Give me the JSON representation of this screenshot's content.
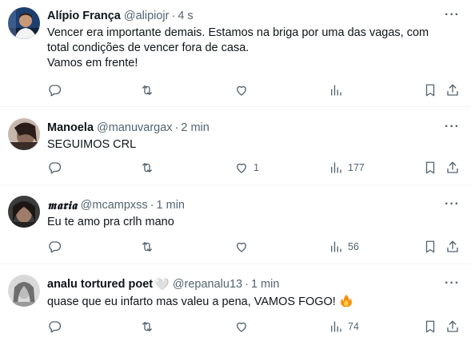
{
  "tweets": [
    {
      "name": "Alípio França",
      "handle": "@alipiojr",
      "separator": "·",
      "time": "4 s",
      "text_lines": [
        "Vencer era importante demais. Estamos na briga por uma das vagas, com",
        "total condições de vencer fora de casa.",
        "Vamos em frente!"
      ],
      "likes": "",
      "views": ""
    },
    {
      "name": "Manoela",
      "handle": "@manuvargax",
      "separator": "·",
      "time": "2 min",
      "text_lines": [
        "SEGUIMOS CRL"
      ],
      "likes": "1",
      "views": "177"
    },
    {
      "name": "𝖒𝖆𝖗𝖎𝖆",
      "handle": "@mcampxss",
      "separator": "·",
      "time": "1 min",
      "text_lines": [
        "Eu te amo pra crlh mano"
      ],
      "likes": "",
      "views": "56"
    },
    {
      "name": "analu tortured poet",
      "name_badge": "🤍",
      "handle": "@repanalu13",
      "separator": "·",
      "time": "1 min",
      "text_lines": [
        "quase que eu infarto mas valeu a pena, VAMOS FOGO!"
      ],
      "text_emoji": "fire-emoji",
      "likes": "",
      "views": "74"
    }
  ],
  "icons": [
    "reply-icon",
    "retweet-icon",
    "like-icon",
    "views-icon",
    "bookmark-icon",
    "share-icon",
    "more-icon"
  ],
  "colors": {
    "text": "#0f1419",
    "secondary": "#536471",
    "divider": "#eff3f4"
  }
}
